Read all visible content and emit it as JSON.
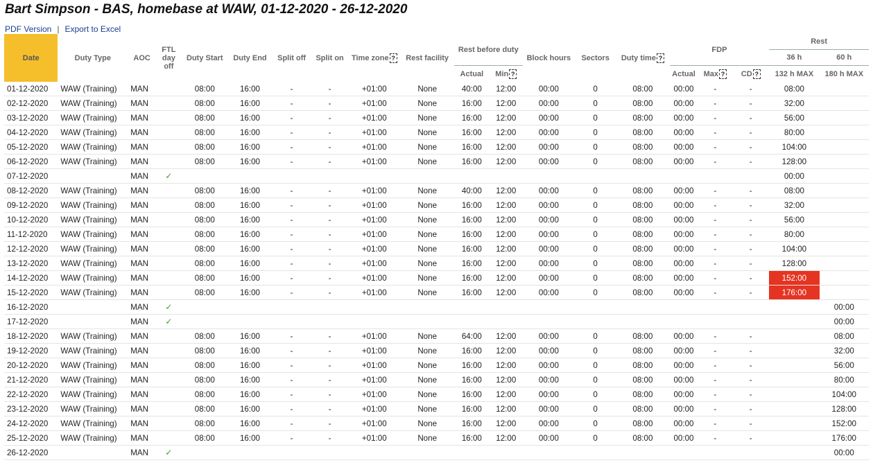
{
  "page": {
    "title": "Bart Simpson - BAS, homebase at WAW, 01-12-2020 - 26-12-2020",
    "pdf_link": "PDF Version",
    "separator": "|",
    "excel_link": "Export to Excel"
  },
  "headers": {
    "date": "Date",
    "duty_type": "Duty Type",
    "aoc": "AOC",
    "ftl_day_off_1": "FTL",
    "ftl_day_off_2": "day",
    "ftl_day_off_3": "off",
    "duty_start": "Duty Start",
    "duty_end": "Duty End",
    "split_off": "Split off",
    "split_on": "Split on",
    "time_zone": "Time zone",
    "rest_facility": "Rest facility",
    "rest_before_duty": "Rest before duty",
    "rbd_actual": "Actual",
    "rbd_min": "Min",
    "block_hours": "Block hours",
    "sectors": "Sectors",
    "duty_time": "Duty time",
    "fdp": "FDP",
    "fdp_actual": "Actual",
    "fdp_max": "Max",
    "fdp_cd": "CD",
    "rest": "Rest",
    "rest_36": "36 h",
    "rest_60": "60 h",
    "rest_36_max": "132 h MAX",
    "rest_60_max": "180 h MAX",
    "help_mark": "?"
  },
  "check_mark": "✓",
  "rows": [
    {
      "date": "01-12-2020",
      "duty_type": "WAW (Training)",
      "aoc": "MAN",
      "day_off": false,
      "start": "08:00",
      "end": "16:00",
      "split_off": "-",
      "split_on": "-",
      "tz": "+01:00",
      "facility": "None",
      "rbd_actual": "40:00",
      "rbd_min": "12:00",
      "block": "00:00",
      "sectors": "0",
      "duty_time": "08:00",
      "fdp_actual": "00:00",
      "fdp_max": "-",
      "fdp_cd": "-",
      "rest36": "08:00",
      "rest60": "",
      "warn36": false
    },
    {
      "date": "02-12-2020",
      "duty_type": "WAW (Training)",
      "aoc": "MAN",
      "day_off": false,
      "start": "08:00",
      "end": "16:00",
      "split_off": "-",
      "split_on": "-",
      "tz": "+01:00",
      "facility": "None",
      "rbd_actual": "16:00",
      "rbd_min": "12:00",
      "block": "00:00",
      "sectors": "0",
      "duty_time": "08:00",
      "fdp_actual": "00:00",
      "fdp_max": "-",
      "fdp_cd": "-",
      "rest36": "32:00",
      "rest60": "",
      "warn36": false
    },
    {
      "date": "03-12-2020",
      "duty_type": "WAW (Training)",
      "aoc": "MAN",
      "day_off": false,
      "start": "08:00",
      "end": "16:00",
      "split_off": "-",
      "split_on": "-",
      "tz": "+01:00",
      "facility": "None",
      "rbd_actual": "16:00",
      "rbd_min": "12:00",
      "block": "00:00",
      "sectors": "0",
      "duty_time": "08:00",
      "fdp_actual": "00:00",
      "fdp_max": "-",
      "fdp_cd": "-",
      "rest36": "56:00",
      "rest60": "",
      "warn36": false
    },
    {
      "date": "04-12-2020",
      "duty_type": "WAW (Training)",
      "aoc": "MAN",
      "day_off": false,
      "start": "08:00",
      "end": "16:00",
      "split_off": "-",
      "split_on": "-",
      "tz": "+01:00",
      "facility": "None",
      "rbd_actual": "16:00",
      "rbd_min": "12:00",
      "block": "00:00",
      "sectors": "0",
      "duty_time": "08:00",
      "fdp_actual": "00:00",
      "fdp_max": "-",
      "fdp_cd": "-",
      "rest36": "80:00",
      "rest60": "",
      "warn36": false
    },
    {
      "date": "05-12-2020",
      "duty_type": "WAW (Training)",
      "aoc": "MAN",
      "day_off": false,
      "start": "08:00",
      "end": "16:00",
      "split_off": "-",
      "split_on": "-",
      "tz": "+01:00",
      "facility": "None",
      "rbd_actual": "16:00",
      "rbd_min": "12:00",
      "block": "00:00",
      "sectors": "0",
      "duty_time": "08:00",
      "fdp_actual": "00:00",
      "fdp_max": "-",
      "fdp_cd": "-",
      "rest36": "104:00",
      "rest60": "",
      "warn36": false
    },
    {
      "date": "06-12-2020",
      "duty_type": "WAW (Training)",
      "aoc": "MAN",
      "day_off": false,
      "start": "08:00",
      "end": "16:00",
      "split_off": "-",
      "split_on": "-",
      "tz": "+01:00",
      "facility": "None",
      "rbd_actual": "16:00",
      "rbd_min": "12:00",
      "block": "00:00",
      "sectors": "0",
      "duty_time": "08:00",
      "fdp_actual": "00:00",
      "fdp_max": "-",
      "fdp_cd": "-",
      "rest36": "128:00",
      "rest60": "",
      "warn36": false
    },
    {
      "date": "07-12-2020",
      "duty_type": "",
      "aoc": "MAN",
      "day_off": true,
      "start": "",
      "end": "",
      "split_off": "",
      "split_on": "",
      "tz": "",
      "facility": "",
      "rbd_actual": "",
      "rbd_min": "",
      "block": "",
      "sectors": "",
      "duty_time": "",
      "fdp_actual": "",
      "fdp_max": "",
      "fdp_cd": "",
      "rest36": "00:00",
      "rest60": "",
      "warn36": false
    },
    {
      "date": "08-12-2020",
      "duty_type": "WAW (Training)",
      "aoc": "MAN",
      "day_off": false,
      "start": "08:00",
      "end": "16:00",
      "split_off": "-",
      "split_on": "-",
      "tz": "+01:00",
      "facility": "None",
      "rbd_actual": "40:00",
      "rbd_min": "12:00",
      "block": "00:00",
      "sectors": "0",
      "duty_time": "08:00",
      "fdp_actual": "00:00",
      "fdp_max": "-",
      "fdp_cd": "-",
      "rest36": "08:00",
      "rest60": "",
      "warn36": false
    },
    {
      "date": "09-12-2020",
      "duty_type": "WAW (Training)",
      "aoc": "MAN",
      "day_off": false,
      "start": "08:00",
      "end": "16:00",
      "split_off": "-",
      "split_on": "-",
      "tz": "+01:00",
      "facility": "None",
      "rbd_actual": "16:00",
      "rbd_min": "12:00",
      "block": "00:00",
      "sectors": "0",
      "duty_time": "08:00",
      "fdp_actual": "00:00",
      "fdp_max": "-",
      "fdp_cd": "-",
      "rest36": "32:00",
      "rest60": "",
      "warn36": false
    },
    {
      "date": "10-12-2020",
      "duty_type": "WAW (Training)",
      "aoc": "MAN",
      "day_off": false,
      "start": "08:00",
      "end": "16:00",
      "split_off": "-",
      "split_on": "-",
      "tz": "+01:00",
      "facility": "None",
      "rbd_actual": "16:00",
      "rbd_min": "12:00",
      "block": "00:00",
      "sectors": "0",
      "duty_time": "08:00",
      "fdp_actual": "00:00",
      "fdp_max": "-",
      "fdp_cd": "-",
      "rest36": "56:00",
      "rest60": "",
      "warn36": false
    },
    {
      "date": "11-12-2020",
      "duty_type": "WAW (Training)",
      "aoc": "MAN",
      "day_off": false,
      "start": "08:00",
      "end": "16:00",
      "split_off": "-",
      "split_on": "-",
      "tz": "+01:00",
      "facility": "None",
      "rbd_actual": "16:00",
      "rbd_min": "12:00",
      "block": "00:00",
      "sectors": "0",
      "duty_time": "08:00",
      "fdp_actual": "00:00",
      "fdp_max": "-",
      "fdp_cd": "-",
      "rest36": "80:00",
      "rest60": "",
      "warn36": false
    },
    {
      "date": "12-12-2020",
      "duty_type": "WAW (Training)",
      "aoc": "MAN",
      "day_off": false,
      "start": "08:00",
      "end": "16:00",
      "split_off": "-",
      "split_on": "-",
      "tz": "+01:00",
      "facility": "None",
      "rbd_actual": "16:00",
      "rbd_min": "12:00",
      "block": "00:00",
      "sectors": "0",
      "duty_time": "08:00",
      "fdp_actual": "00:00",
      "fdp_max": "-",
      "fdp_cd": "-",
      "rest36": "104:00",
      "rest60": "",
      "warn36": false
    },
    {
      "date": "13-12-2020",
      "duty_type": "WAW (Training)",
      "aoc": "MAN",
      "day_off": false,
      "start": "08:00",
      "end": "16:00",
      "split_off": "-",
      "split_on": "-",
      "tz": "+01:00",
      "facility": "None",
      "rbd_actual": "16:00",
      "rbd_min": "12:00",
      "block": "00:00",
      "sectors": "0",
      "duty_time": "08:00",
      "fdp_actual": "00:00",
      "fdp_max": "-",
      "fdp_cd": "-",
      "rest36": "128:00",
      "rest60": "",
      "warn36": false
    },
    {
      "date": "14-12-2020",
      "duty_type": "WAW (Training)",
      "aoc": "MAN",
      "day_off": false,
      "start": "08:00",
      "end": "16:00",
      "split_off": "-",
      "split_on": "-",
      "tz": "+01:00",
      "facility": "None",
      "rbd_actual": "16:00",
      "rbd_min": "12:00",
      "block": "00:00",
      "sectors": "0",
      "duty_time": "08:00",
      "fdp_actual": "00:00",
      "fdp_max": "-",
      "fdp_cd": "-",
      "rest36": "152:00",
      "rest60": "",
      "warn36": true
    },
    {
      "date": "15-12-2020",
      "duty_type": "WAW (Training)",
      "aoc": "MAN",
      "day_off": false,
      "start": "08:00",
      "end": "16:00",
      "split_off": "-",
      "split_on": "-",
      "tz": "+01:00",
      "facility": "None",
      "rbd_actual": "16:00",
      "rbd_min": "12:00",
      "block": "00:00",
      "sectors": "0",
      "duty_time": "08:00",
      "fdp_actual": "00:00",
      "fdp_max": "-",
      "fdp_cd": "-",
      "rest36": "176:00",
      "rest60": "",
      "warn36": true
    },
    {
      "date": "16-12-2020",
      "duty_type": "",
      "aoc": "MAN",
      "day_off": true,
      "start": "",
      "end": "",
      "split_off": "",
      "split_on": "",
      "tz": "",
      "facility": "",
      "rbd_actual": "",
      "rbd_min": "",
      "block": "",
      "sectors": "",
      "duty_time": "",
      "fdp_actual": "",
      "fdp_max": "",
      "fdp_cd": "",
      "rest36": "",
      "rest60": "00:00",
      "warn36": false
    },
    {
      "date": "17-12-2020",
      "duty_type": "",
      "aoc": "MAN",
      "day_off": true,
      "start": "",
      "end": "",
      "split_off": "",
      "split_on": "",
      "tz": "",
      "facility": "",
      "rbd_actual": "",
      "rbd_min": "",
      "block": "",
      "sectors": "",
      "duty_time": "",
      "fdp_actual": "",
      "fdp_max": "",
      "fdp_cd": "",
      "rest36": "",
      "rest60": "00:00",
      "warn36": false
    },
    {
      "date": "18-12-2020",
      "duty_type": "WAW (Training)",
      "aoc": "MAN",
      "day_off": false,
      "start": "08:00",
      "end": "16:00",
      "split_off": "-",
      "split_on": "-",
      "tz": "+01:00",
      "facility": "None",
      "rbd_actual": "64:00",
      "rbd_min": "12:00",
      "block": "00:00",
      "sectors": "0",
      "duty_time": "08:00",
      "fdp_actual": "00:00",
      "fdp_max": "-",
      "fdp_cd": "-",
      "rest36": "",
      "rest60": "08:00",
      "warn36": false
    },
    {
      "date": "19-12-2020",
      "duty_type": "WAW (Training)",
      "aoc": "MAN",
      "day_off": false,
      "start": "08:00",
      "end": "16:00",
      "split_off": "-",
      "split_on": "-",
      "tz": "+01:00",
      "facility": "None",
      "rbd_actual": "16:00",
      "rbd_min": "12:00",
      "block": "00:00",
      "sectors": "0",
      "duty_time": "08:00",
      "fdp_actual": "00:00",
      "fdp_max": "-",
      "fdp_cd": "-",
      "rest36": "",
      "rest60": "32:00",
      "warn36": false
    },
    {
      "date": "20-12-2020",
      "duty_type": "WAW (Training)",
      "aoc": "MAN",
      "day_off": false,
      "start": "08:00",
      "end": "16:00",
      "split_off": "-",
      "split_on": "-",
      "tz": "+01:00",
      "facility": "None",
      "rbd_actual": "16:00",
      "rbd_min": "12:00",
      "block": "00:00",
      "sectors": "0",
      "duty_time": "08:00",
      "fdp_actual": "00:00",
      "fdp_max": "-",
      "fdp_cd": "-",
      "rest36": "",
      "rest60": "56:00",
      "warn36": false
    },
    {
      "date": "21-12-2020",
      "duty_type": "WAW (Training)",
      "aoc": "MAN",
      "day_off": false,
      "start": "08:00",
      "end": "16:00",
      "split_off": "-",
      "split_on": "-",
      "tz": "+01:00",
      "facility": "None",
      "rbd_actual": "16:00",
      "rbd_min": "12:00",
      "block": "00:00",
      "sectors": "0",
      "duty_time": "08:00",
      "fdp_actual": "00:00",
      "fdp_max": "-",
      "fdp_cd": "-",
      "rest36": "",
      "rest60": "80:00",
      "warn36": false
    },
    {
      "date": "22-12-2020",
      "duty_type": "WAW (Training)",
      "aoc": "MAN",
      "day_off": false,
      "start": "08:00",
      "end": "16:00",
      "split_off": "-",
      "split_on": "-",
      "tz": "+01:00",
      "facility": "None",
      "rbd_actual": "16:00",
      "rbd_min": "12:00",
      "block": "00:00",
      "sectors": "0",
      "duty_time": "08:00",
      "fdp_actual": "00:00",
      "fdp_max": "-",
      "fdp_cd": "-",
      "rest36": "",
      "rest60": "104:00",
      "warn36": false
    },
    {
      "date": "23-12-2020",
      "duty_type": "WAW (Training)",
      "aoc": "MAN",
      "day_off": false,
      "start": "08:00",
      "end": "16:00",
      "split_off": "-",
      "split_on": "-",
      "tz": "+01:00",
      "facility": "None",
      "rbd_actual": "16:00",
      "rbd_min": "12:00",
      "block": "00:00",
      "sectors": "0",
      "duty_time": "08:00",
      "fdp_actual": "00:00",
      "fdp_max": "-",
      "fdp_cd": "-",
      "rest36": "",
      "rest60": "128:00",
      "warn36": false
    },
    {
      "date": "24-12-2020",
      "duty_type": "WAW (Training)",
      "aoc": "MAN",
      "day_off": false,
      "start": "08:00",
      "end": "16:00",
      "split_off": "-",
      "split_on": "-",
      "tz": "+01:00",
      "facility": "None",
      "rbd_actual": "16:00",
      "rbd_min": "12:00",
      "block": "00:00",
      "sectors": "0",
      "duty_time": "08:00",
      "fdp_actual": "00:00",
      "fdp_max": "-",
      "fdp_cd": "-",
      "rest36": "",
      "rest60": "152:00",
      "warn36": false
    },
    {
      "date": "25-12-2020",
      "duty_type": "WAW (Training)",
      "aoc": "MAN",
      "day_off": false,
      "start": "08:00",
      "end": "16:00",
      "split_off": "-",
      "split_on": "-",
      "tz": "+01:00",
      "facility": "None",
      "rbd_actual": "16:00",
      "rbd_min": "12:00",
      "block": "00:00",
      "sectors": "0",
      "duty_time": "08:00",
      "fdp_actual": "00:00",
      "fdp_max": "-",
      "fdp_cd": "-",
      "rest36": "",
      "rest60": "176:00",
      "warn36": false
    },
    {
      "date": "26-12-2020",
      "duty_type": "",
      "aoc": "MAN",
      "day_off": true,
      "start": "",
      "end": "",
      "split_off": "",
      "split_on": "",
      "tz": "",
      "facility": "",
      "rbd_actual": "",
      "rbd_min": "",
      "block": "",
      "sectors": "",
      "duty_time": "",
      "fdp_actual": "",
      "fdp_max": "",
      "fdp_cd": "",
      "rest36": "",
      "rest60": "00:00",
      "warn36": false
    }
  ]
}
